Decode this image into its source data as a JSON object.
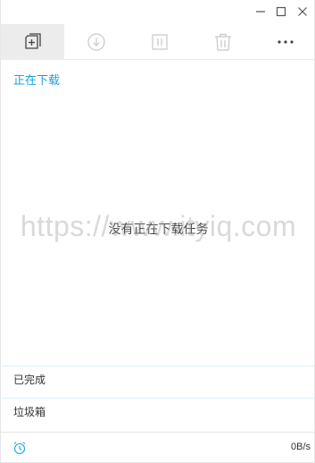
{
  "window_controls": {
    "minimize_icon": "minimize-icon",
    "maximize_icon": "maximize-icon",
    "close_icon": "close-icon"
  },
  "toolbar": {
    "items": [
      {
        "name": "new-task",
        "icon": "add-square-icon",
        "active": true
      },
      {
        "name": "start",
        "icon": "download-circle-icon",
        "active": false
      },
      {
        "name": "pause",
        "icon": "pause-icon",
        "active": false
      },
      {
        "name": "delete",
        "icon": "trash-icon",
        "active": false
      },
      {
        "name": "more",
        "icon": "more-dots-icon",
        "active": false
      }
    ]
  },
  "downloading": {
    "title": "正在下载",
    "empty_message": "没有正在下载任务"
  },
  "watermark": "https://www.ityiq.com",
  "sections": {
    "completed_label": "已完成",
    "trash_label": "垃圾箱"
  },
  "status": {
    "speed": "0B/s",
    "alarm_icon": "alarm-clock-icon"
  },
  "colors": {
    "accent": "#1ba1e2",
    "toolbar_active_bg": "#ececec",
    "icon_disabled": "#c8c8c8"
  }
}
